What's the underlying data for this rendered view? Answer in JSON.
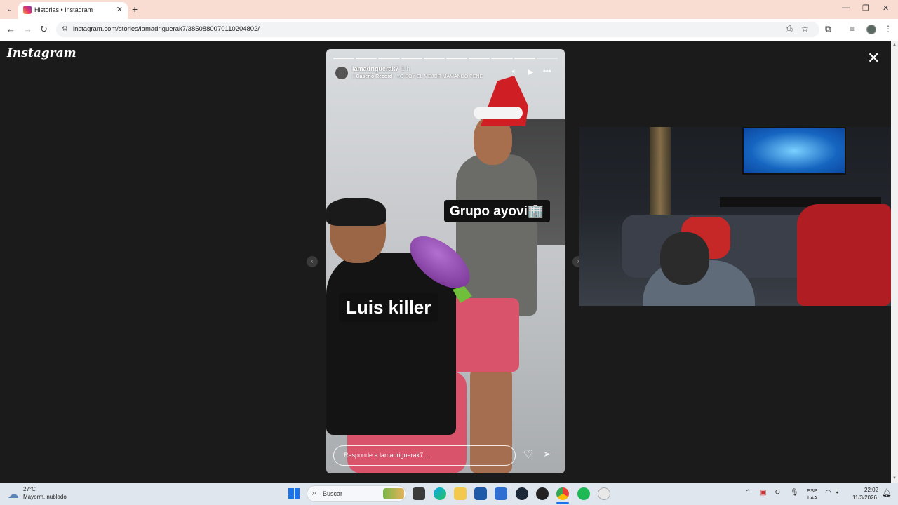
{
  "browser": {
    "tab_title": "Historias • Instagram",
    "tab_close": "✕",
    "new_tab": "+",
    "url": "instagram.com/stories/lamadriguerak7/3850880070110204802/",
    "nav_icons": [
      "back-icon",
      "forward-icon",
      "reload-icon"
    ],
    "window_controls": [
      "minimize-icon",
      "restore-icon",
      "close-icon"
    ]
  },
  "instagram": {
    "logo": "Instagram",
    "close": "✕"
  },
  "story": {
    "username": "lamadriguerak7",
    "time": "1 h",
    "music_artist": "Caserío Record",
    "music_separator": " · ",
    "music_track": "YO SOY EL MEJOR MAMANDO PENE",
    "music_icon": "ıl",
    "progress_total": 10,
    "progress_done": 9,
    "sticker_top": "Grupo ayovi🏢",
    "sticker_bottom": "Luis killer",
    "reply_placeholder": "Responde a lamadriguerak7...",
    "icons": [
      "mute-icon",
      "play-icon",
      "more-icon",
      "heart-icon",
      "send-icon"
    ]
  },
  "taskbar": {
    "weather_temp": "27°C",
    "weather_desc": "Mayorm. nublado",
    "search_label": "Buscar",
    "lang_line1": "ESP",
    "lang_line2": "LAA",
    "time": "22:02",
    "date": "11/3/2026"
  },
  "colors": {
    "tab_strip": "#f9dcd2",
    "page_bg": "#1b1b1b",
    "taskbar": "#dfe6ee"
  }
}
